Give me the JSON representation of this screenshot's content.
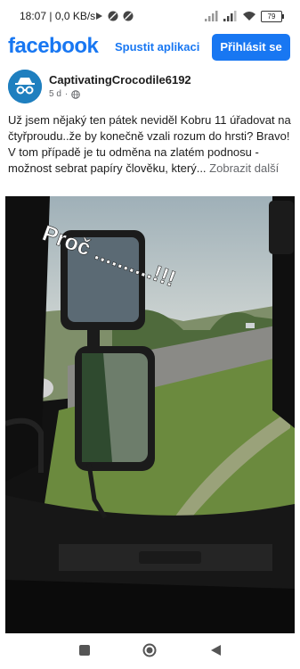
{
  "status_bar": {
    "time": "18:07",
    "net_speed": "0,0 KB/s",
    "battery": "79"
  },
  "header": {
    "logo": "facebook",
    "open_app": "Spustit aplikaci",
    "login": "Přihlásit se"
  },
  "post": {
    "author": "CaptivatingCrocodile6192",
    "age": "5 d",
    "visibility_icon": "globe-icon",
    "text_lines": [
      "Už jsem nějaký ten pátek neviděl Kobru 11 úřadovat na čtyřproudu..že by konečně vzali rozum do hrsti? Bravo!",
      "V tom případě je tu odměna na zlatém podnosu - možnost sebrat papíry člověku, který..."
    ],
    "more_link": "Zobrazit další"
  },
  "video": {
    "overlay_text": "Proč ..........!!!"
  },
  "colors": {
    "brand": "#1877f2",
    "text": "#1c1c1c",
    "muted": "#65676b"
  },
  "nav": {
    "icons": [
      "recent-apps-icon",
      "home-icon",
      "back-icon"
    ]
  }
}
